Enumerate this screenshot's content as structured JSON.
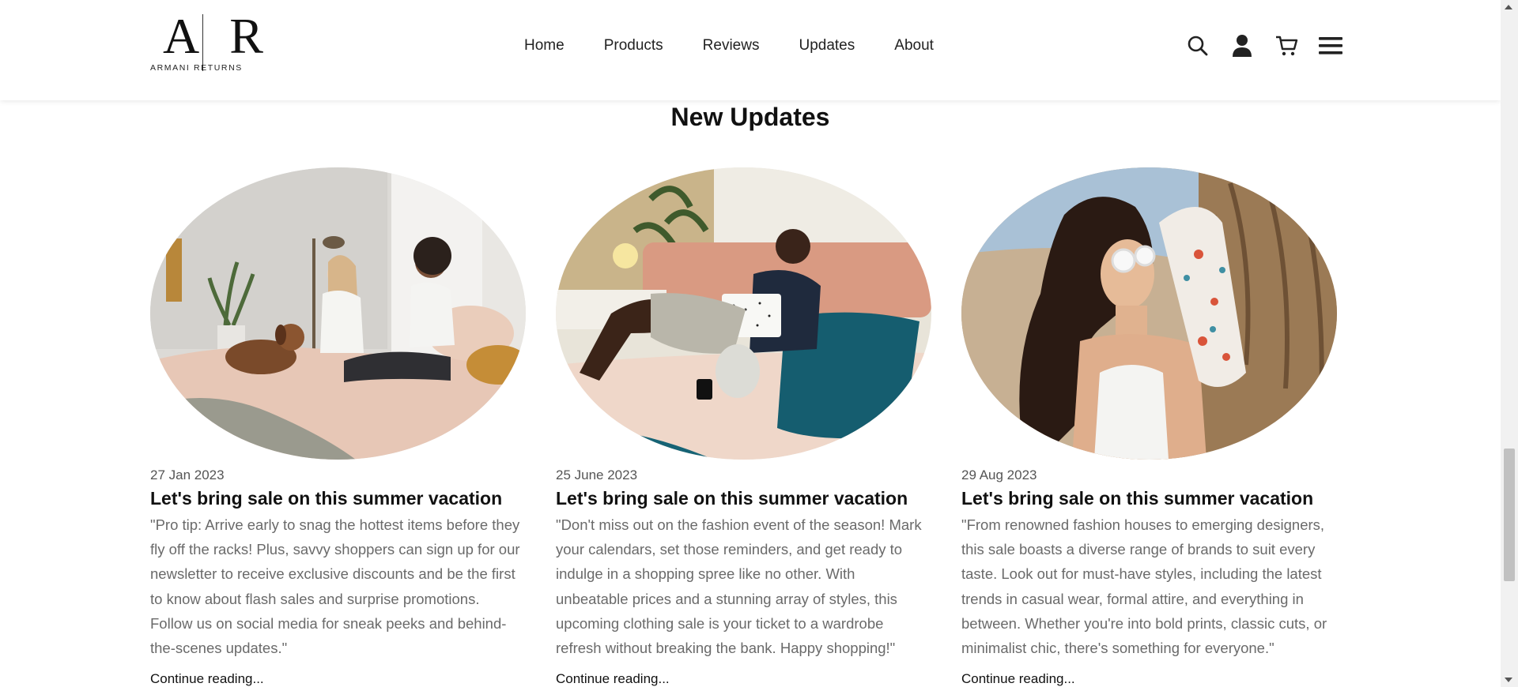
{
  "header": {
    "logo": {
      "mark": "A|R",
      "text": "ARMANI RETURNS"
    },
    "nav": [
      {
        "label": "Home"
      },
      {
        "label": "Products"
      },
      {
        "label": "Reviews"
      },
      {
        "label": "Updates"
      },
      {
        "label": "About"
      }
    ],
    "icons": [
      "search-icon",
      "user-icon",
      "cart-icon",
      "menu-icon"
    ]
  },
  "section": {
    "title": "New Updates",
    "cards": [
      {
        "date": "27 Jan 2023",
        "title": "Let's bring sale on this summer vacation",
        "excerpt": "\"Pro tip: Arrive early to snag the hottest items before they fly off the racks! Plus, savvy shoppers can sign up for our newsletter to receive exclusive discounts and be the first to know about flash sales and surprise promotions. Follow us on social media for sneak peeks and behind-the-scenes updates.\"",
        "link": "Continue reading..."
      },
      {
        "date": "25 June 2023",
        "title": "Let's bring sale on this summer vacation",
        "excerpt": "\"Don't miss out on the fashion event of the season! Mark your calendars, set those reminders, and get ready to indulge in a shopping spree like no other. With unbeatable prices and a stunning array of styles, this upcoming clothing sale is your ticket to a wardrobe refresh without breaking the bank. Happy shopping!\"",
        "link": "Continue reading..."
      },
      {
        "date": "29 Aug 2023",
        "title": "Let's bring sale on this summer vacation",
        "excerpt": "\"From renowned fashion houses to emerging designers, this sale boasts a diverse range of brands to suit every taste. Look out for must-have styles, including the latest trends in casual wear, formal attire, and everything in between. Whether you're into bold prints, classic cuts, or minimalist chic, there's something for everyone.\"",
        "link": "Continue reading..."
      }
    ]
  },
  "colors": {
    "text": "#111111",
    "muted": "#6a6a6a",
    "date": "#555555",
    "background": "#ffffff"
  }
}
